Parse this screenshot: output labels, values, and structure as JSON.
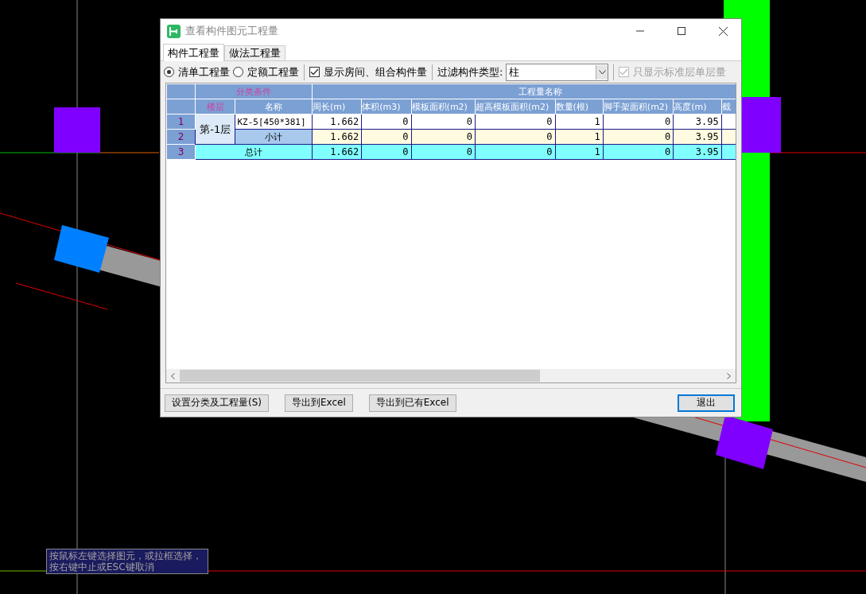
{
  "canvas": {
    "hint": "按鼠标左键选择图元，或拉框选择，按右键中止或ESC键取消"
  },
  "dialog": {
    "title": "查看构件图元工程量",
    "tabs": [
      {
        "label": "构件工程量",
        "selected": true
      },
      {
        "label": "做法工程量",
        "selected": false
      }
    ],
    "radios": [
      {
        "label": "清单工程量",
        "selected": true
      },
      {
        "label": "定额工程量",
        "selected": false
      }
    ],
    "show_rooms": {
      "label": "显示房间、组合构件量",
      "checked": true
    },
    "filter": {
      "label": "过滤构件类型:",
      "value": "柱"
    },
    "standard_floor": {
      "label": "只显示标准层单层量",
      "checked": true,
      "disabled": true
    },
    "table": {
      "group_headers": [
        "分类条件",
        "工程量名称"
      ],
      "columns": [
        "楼层",
        "名称",
        "周长(m)",
        "体积(m3)",
        "模板面积(m2)",
        "超高模板面积(m2)",
        "数量(根)",
        "脚手架面积(m2)",
        "高度(m)",
        "截"
      ],
      "groups": [
        {
          "floor": "第-1层",
          "rows": [
            {
              "row_number": "1",
              "kind": "item",
              "name": "KZ-5[450*381]",
              "values": [
                "1.662",
                "0",
                "0",
                "0",
                "1",
                "0",
                "3.95"
              ]
            },
            {
              "row_number": "2",
              "kind": "subtotal",
              "name": "小计",
              "values": [
                "1.662",
                "0",
                "0",
                "0",
                "1",
                "0",
                "3.95"
              ]
            }
          ]
        }
      ],
      "total": {
        "row_number": "3",
        "label": "总计",
        "values": [
          "1.662",
          "0",
          "0",
          "0",
          "1",
          "0",
          "3.95"
        ]
      }
    },
    "buttons": [
      {
        "label": "设置分类及工程量(S)",
        "default": false
      },
      {
        "label": "导出到Excel",
        "default": false
      },
      {
        "label": "导出到已有Excel",
        "default": false
      },
      {
        "label": "退出",
        "default": true
      }
    ]
  }
}
